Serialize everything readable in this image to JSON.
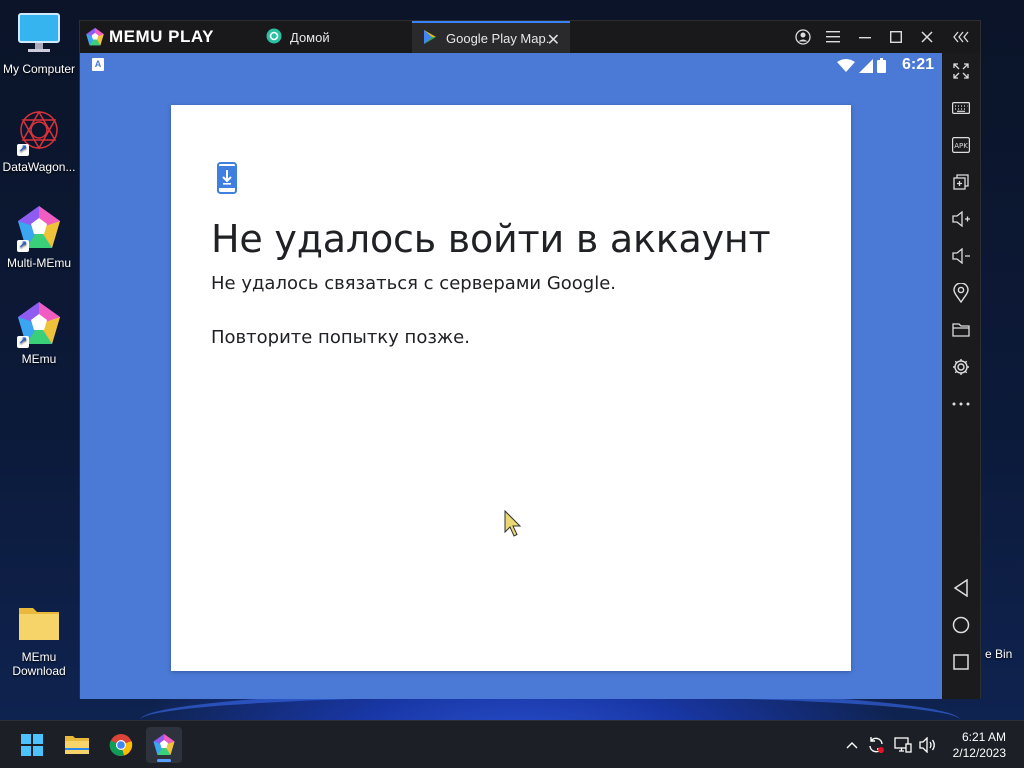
{
  "desktop": {
    "icons": [
      {
        "label": "My Computer"
      },
      {
        "label": "DataWagon..."
      },
      {
        "label": "Multi-MEmu"
      },
      {
        "label": "MEmu"
      },
      {
        "label": "MEmu Download"
      }
    ],
    "recycle_bin_label": "e Bin"
  },
  "emulator": {
    "logo": "MEMU PLAY",
    "tabs": [
      {
        "label": "Домой"
      },
      {
        "label": "Google Play Map."
      }
    ],
    "tab_close": "✕",
    "statusbar": {
      "time": "6:21",
      "left_badge": "A"
    },
    "dialog": {
      "title": "Не удалось войти в аккаунт",
      "line1": "Не удалось связаться с серверами Google.",
      "line2": "Повторите попытку позже."
    },
    "sidebar_tools": [
      "fullscreen-icon",
      "keyboard-icon",
      "apk-icon",
      "multi-window-icon",
      "volume-up-icon",
      "volume-down-icon",
      "location-icon",
      "folder-icon",
      "settings-icon",
      "more-icon",
      "back-icon",
      "home-icon",
      "recents-icon"
    ],
    "apk_label": "APK"
  },
  "taskbar": {
    "clock_time": "6:21 AM",
    "clock_date": "2/12/2023"
  },
  "colors": {
    "android_bg": "#4a79d6",
    "dialog_icon": "#3f7fe0",
    "taskbar": "#1c1f26"
  }
}
